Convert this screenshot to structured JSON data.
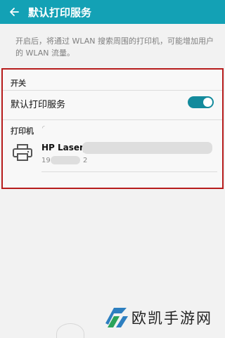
{
  "header": {
    "title": "默认打印服务"
  },
  "description": "开启后，将通过 WLAN 搜索周围的打印机，可能增加用户的 WLAN 流量。",
  "switch_section": {
    "label": "开关",
    "item_label": "默认打印服务",
    "enabled": true
  },
  "printer_section": {
    "label": "打印机",
    "printer": {
      "name": "HP LaserJ",
      "address_start": "19",
      "address_end": "2"
    }
  },
  "watermark": {
    "brand": "欧凯手游网"
  },
  "colors": {
    "appbar": "#13a1b5",
    "toggle": "#138a9c",
    "highlight_border": "#b71c1c"
  },
  "icons": {
    "back": "arrow-left-icon",
    "printer": "printer-icon"
  }
}
